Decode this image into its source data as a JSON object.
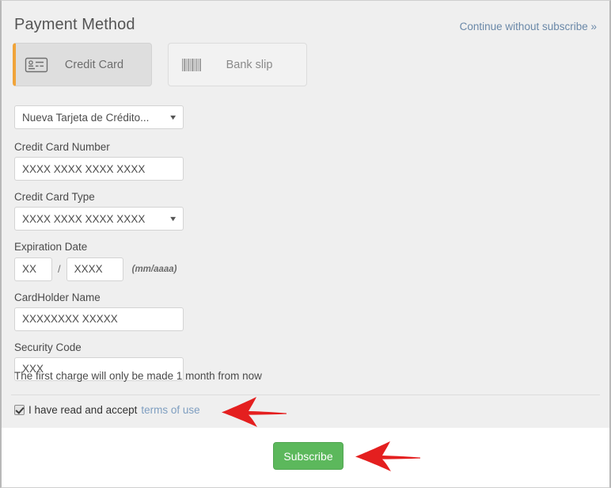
{
  "header": {
    "title": "Payment Method",
    "skip_link": "Continue without subscribe »"
  },
  "payment_tabs": [
    {
      "label": "Credit Card",
      "icon": "credit-card-icon",
      "selected": true
    },
    {
      "label": "Bank slip",
      "icon": "barcode-icon",
      "selected": false
    }
  ],
  "form": {
    "saved_card_select": {
      "value": "Nueva Tarjeta de Crédito...",
      "caret": "▼"
    },
    "card_number": {
      "label": "Credit Card Number",
      "value": "XXXX XXXX XXXX XXXX"
    },
    "card_type": {
      "label": "Credit Card Type",
      "value": "XXXX XXXX XXXX XXXX",
      "caret": "▼"
    },
    "expiration": {
      "label": "Expiration Date",
      "month": "XX",
      "separator": "/",
      "year": "XXXX",
      "hint": "(mm/aaaa)"
    },
    "cardholder": {
      "label": "CardHolder Name",
      "value": "XXXXXXXX XXXXX"
    },
    "security_code": {
      "label": "Security Code",
      "value": "XXX"
    }
  },
  "notes": {
    "charge_note": "The first charge will only be made 1 month from now"
  },
  "terms": {
    "checkbox_checked": true,
    "text": "I have read and accept",
    "link": "terms of use"
  },
  "footer": {
    "subscribe_label": "Subscribe"
  },
  "colors": {
    "accent_orange": "#f0a43a",
    "subscribe_green": "#5cb85c",
    "link_blue": "#6a88a8",
    "panel_gray": "#efefef",
    "annotation_red": "#e01b१b"
  }
}
